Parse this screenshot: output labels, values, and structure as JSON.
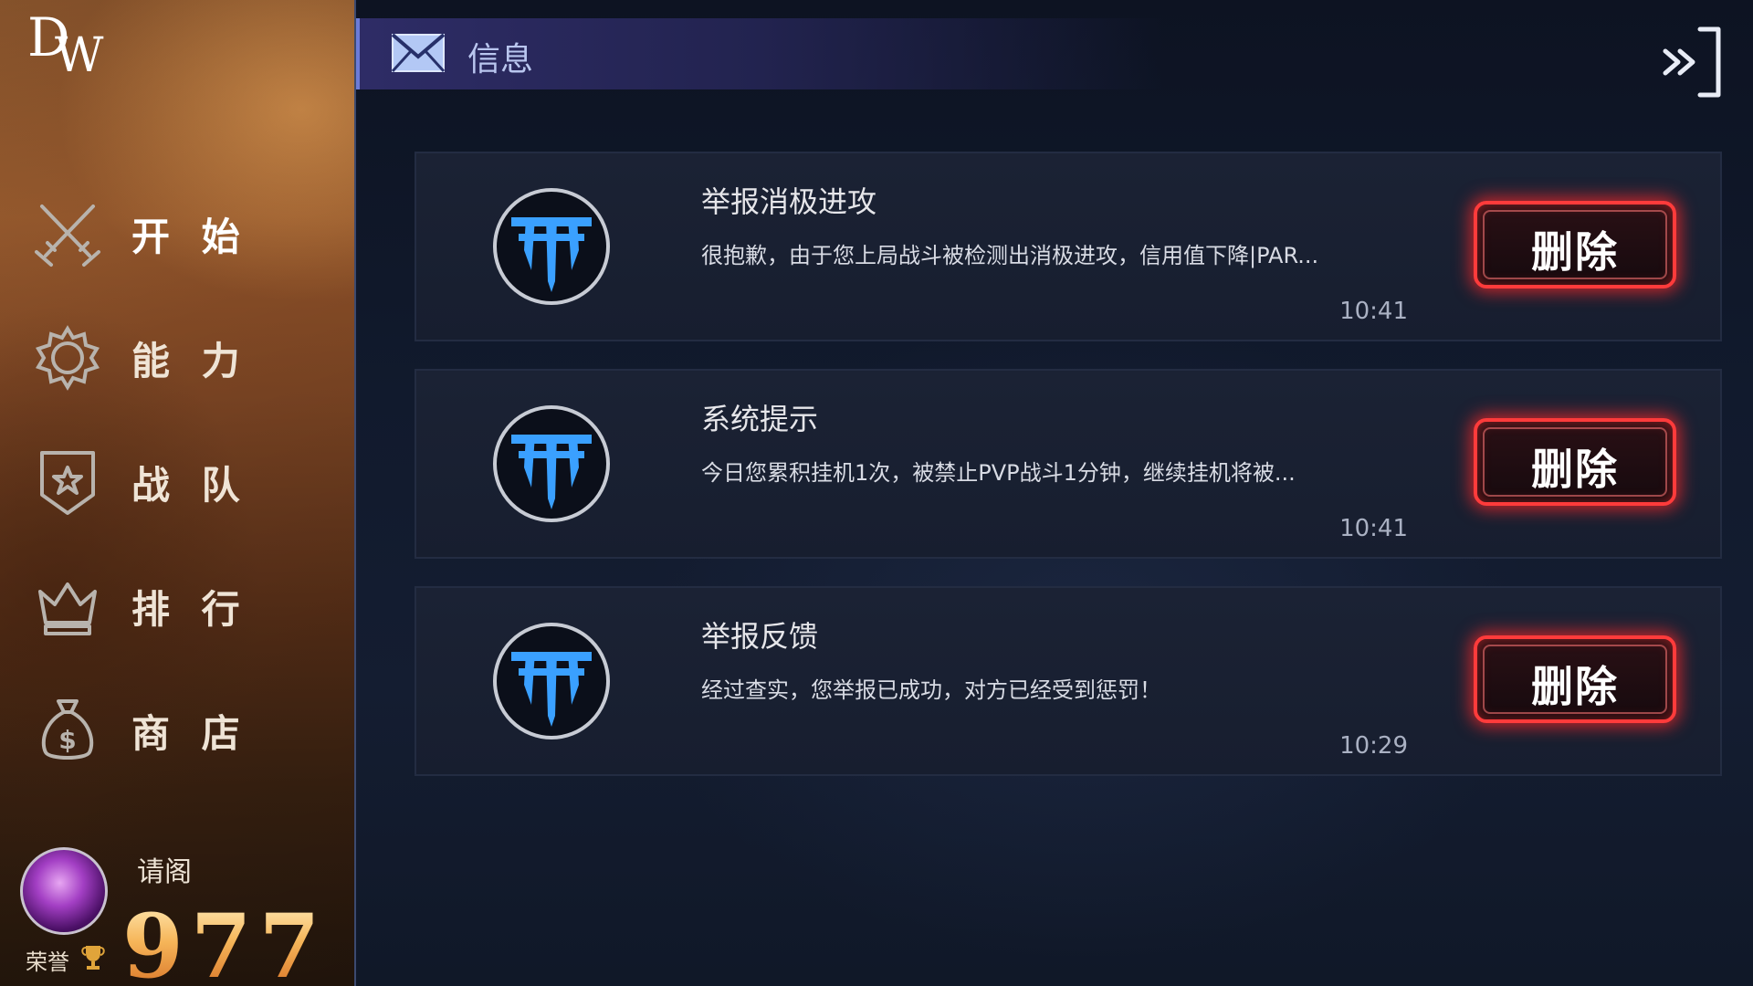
{
  "logo": {
    "letter1": "D",
    "letter2": "W"
  },
  "sidebar": {
    "items": [
      {
        "label": "开 始",
        "icon": "crossed-swords-icon",
        "active": true
      },
      {
        "label": "能 力",
        "icon": "gear-icon",
        "active": false
      },
      {
        "label": "战 队",
        "icon": "shield-star-icon",
        "active": false
      },
      {
        "label": "排 行",
        "icon": "crown-icon",
        "active": false
      },
      {
        "label": "商 店",
        "icon": "money-bag-icon",
        "active": false
      }
    ]
  },
  "profile": {
    "name": "请阁",
    "honor_label": "荣誉",
    "score": "977"
  },
  "header": {
    "title": "信息",
    "icon": "mail-icon",
    "exit_icon": "exit-arrow-icon"
  },
  "messages": [
    {
      "title": "举报消极进攻",
      "body": "很抱歉，由于您上局战斗被检测出消极进攻，信用值下降|PAR...",
      "time": "10:41",
      "delete_label": "删除"
    },
    {
      "title": "系统提示",
      "body": "今日您累积挂机1次，被禁止PVP战斗1分钟，继续挂机将被...",
      "time": "10:41",
      "delete_label": "删除"
    },
    {
      "title": "举报反馈",
      "body": "经过查实，您举报已成功，对方已经受到惩罚！",
      "time": "10:29",
      "delete_label": "删除"
    }
  ],
  "colors": {
    "accent_blue": "#3aa0ff",
    "delete_red": "#ff3b3b",
    "score_orange": "#f0a44a"
  }
}
